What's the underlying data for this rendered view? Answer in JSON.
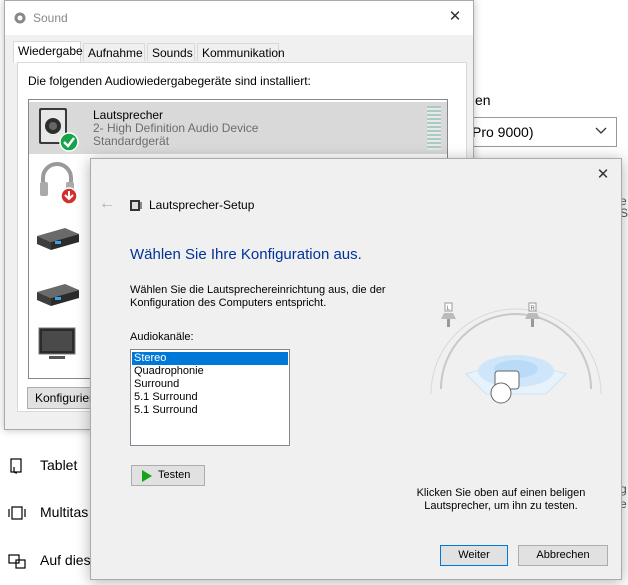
{
  "background": {
    "label_fragment": "en",
    "select_value": "Pro 9000)",
    "right_fragments": [
      "i",
      "e",
      "Sc"
    ],
    "nav_items": [
      {
        "label": "Tablet"
      },
      {
        "label": "Multitas"
      },
      {
        "label": "Auf dies"
      }
    ],
    "right_fragment_bottom": [
      "g",
      "e"
    ]
  },
  "sound_dialog": {
    "title": "Sound",
    "tabs": [
      "Wiedergabe",
      "Aufnahme",
      "Sounds",
      "Kommunikation"
    ],
    "intro": "Die folgenden Audiowiedergabegeräte sind installiert:",
    "devices": [
      {
        "name": "Lautsprecher",
        "line1": "2- High Definition Audio Device",
        "line2": "Standardgerät",
        "status": "default-check",
        "selected": true
      }
    ],
    "configure_label": "Konfigurieren"
  },
  "wizard": {
    "title": "Lautsprecher-Setup",
    "heading": "Wählen Sie Ihre Konfiguration aus.",
    "description": "Wählen Sie die Lautsprechereinrichtung aus, die der Konfiguration des Computers entspricht.",
    "channels_label": "Audiokanäle:",
    "channels": [
      "Stereo",
      "Quadrophonie",
      "Surround",
      "5.1 Surround",
      "5.1 Surround"
    ],
    "selected_channel": "Stereo",
    "test_label": "Testen",
    "hint": "Klicken Sie oben auf einen beligen Lautsprecher, um ihn zu testen.",
    "speaker_labels": {
      "left": "L",
      "right": "R"
    },
    "next_label": "Weiter",
    "cancel_label": "Abbrechen"
  },
  "colors": {
    "accent": "#0078d7",
    "heading": "#003399",
    "play": "#17a317",
    "default_check": "#16a34a"
  }
}
